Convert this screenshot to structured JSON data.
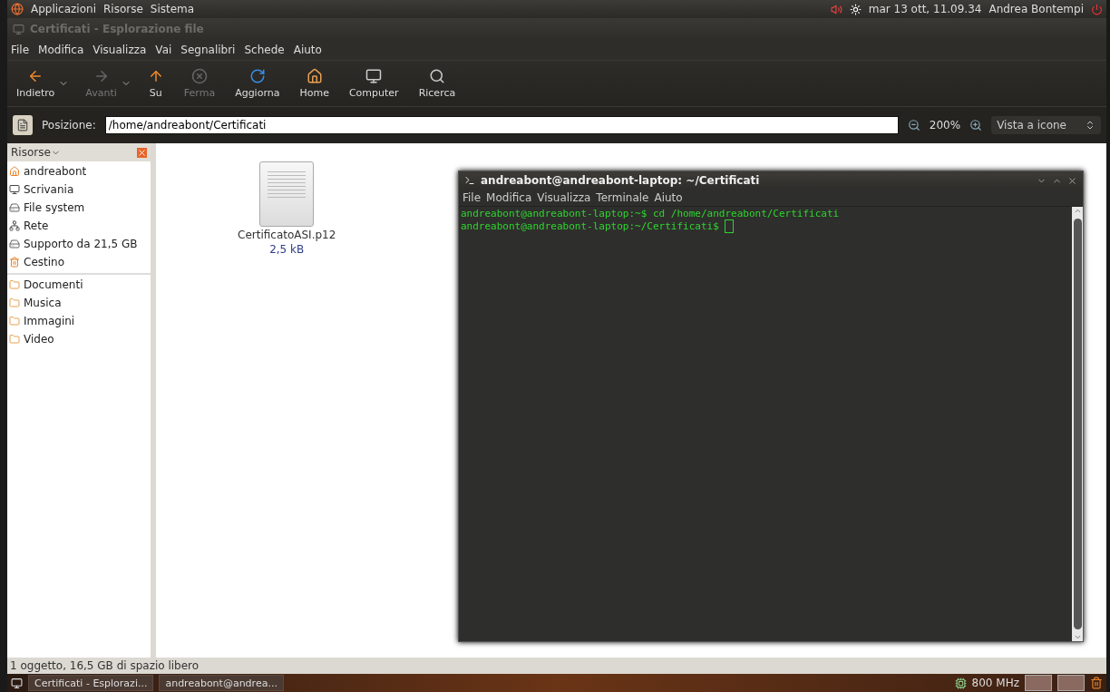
{
  "top_panel": {
    "menus": [
      "Applicazioni",
      "Risorse",
      "Sistema"
    ],
    "clock": "mar 13 ott, 11.09.34",
    "user": "Andrea Bontempi"
  },
  "window": {
    "title": "Certificati - Esplorazione file"
  },
  "menubar": [
    "File",
    "Modifica",
    "Visualizza",
    "Vai",
    "Segnalibri",
    "Schede",
    "Aiuto"
  ],
  "toolbar": [
    {
      "kind": "back",
      "label": "Indietro",
      "disabled": false,
      "dropdown": true
    },
    {
      "kind": "forward",
      "label": "Avanti",
      "disabled": true,
      "dropdown": true
    },
    {
      "kind": "up",
      "label": "Su",
      "disabled": false,
      "dropdown": false
    },
    {
      "kind": "stop",
      "label": "Ferma",
      "disabled": true,
      "dropdown": false
    },
    {
      "kind": "reload",
      "label": "Aggiorna",
      "disabled": false,
      "dropdown": false
    },
    {
      "kind": "home",
      "label": "Home",
      "disabled": false,
      "dropdown": false
    },
    {
      "kind": "computer",
      "label": "Computer",
      "disabled": false,
      "dropdown": false
    },
    {
      "kind": "search",
      "label": "Ricerca",
      "disabled": false,
      "dropdown": false
    }
  ],
  "location": {
    "label": "Posizione:",
    "value": "/home/andreabont/Certificati",
    "zoom": "200%",
    "view": "Vista a icone"
  },
  "sidebar": {
    "title": "Risorse",
    "groups": [
      [
        {
          "kind": "home",
          "label": "andreabont"
        },
        {
          "kind": "desktop",
          "label": "Scrivania"
        },
        {
          "kind": "drive",
          "label": "File system"
        },
        {
          "kind": "network",
          "label": "Rete"
        },
        {
          "kind": "drive",
          "label": "Supporto da 21,5 GB"
        },
        {
          "kind": "trash",
          "label": "Cestino"
        }
      ],
      [
        {
          "kind": "folder",
          "label": "Documenti"
        },
        {
          "kind": "folder",
          "label": "Musica"
        },
        {
          "kind": "folder",
          "label": "Immagini"
        },
        {
          "kind": "folder",
          "label": "Video"
        }
      ]
    ]
  },
  "files": [
    {
      "name": "CertificatoASI.p12",
      "size": "2,5 kB"
    }
  ],
  "status_bar": "1 oggetto, 16,5 GB di spazio libero",
  "terminal": {
    "title": "andreabont@andreabont-laptop: ~/Certificati",
    "menubar": [
      "File",
      "Modifica",
      "Visualizza",
      "Terminale",
      "Aiuto"
    ],
    "lines": [
      "andreabont@andreabont-laptop:~$ cd /home/andreabont/Certificati",
      "andreabont@andreabont-laptop:~/Certificati$ "
    ]
  },
  "taskbar": {
    "tasks": [
      "Certificati - Esplorazi...",
      "andreabont@andrea..."
    ],
    "cpu": "800 MHz"
  }
}
